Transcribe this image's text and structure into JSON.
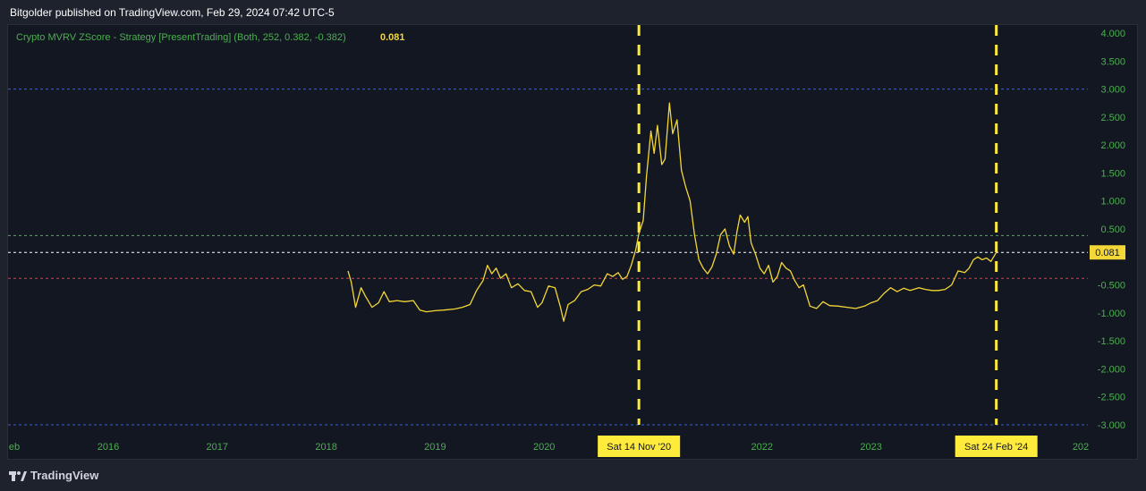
{
  "header": {
    "text": "Bitgolder published on TradingView.com, Feb 29, 2024 07:42 UTC-5"
  },
  "indicator": {
    "label": "Crypto MVRV ZScore - Strategy [PresentTrading] (Both, 252, 0.382, -0.382)",
    "value": "0.081"
  },
  "colors": {
    "background": "#131722",
    "line": "#f3d737",
    "level_blue": "#2962ff",
    "level_green": "#4caf50",
    "level_red": "#f23645",
    "level_white": "#ffffff",
    "marker": "#ffeb3b",
    "axis_text": "#4caf50"
  },
  "footer": {
    "brand": "TradingView"
  },
  "chart_data": {
    "type": "line",
    "ylim": [
      -3.0,
      4.0
    ],
    "y_ticks": [
      "4.000",
      "3.500",
      "3.000",
      "2.500",
      "2.000",
      "1.500",
      "1.000",
      "0.500",
      "0.000",
      "-0.500",
      "-1.000",
      "-1.500",
      "-2.000",
      "-2.500",
      "-3.000"
    ],
    "x_ticks": [
      {
        "label": "eb",
        "x": 2015.1
      },
      {
        "label": "2016",
        "x": 2016.0
      },
      {
        "label": "2017",
        "x": 2017.0
      },
      {
        "label": "2018",
        "x": 2018.0
      },
      {
        "label": "2019",
        "x": 2019.0
      },
      {
        "label": "2020",
        "x": 2020.0
      },
      {
        "label": "2022",
        "x": 2022.0
      },
      {
        "label": "2023",
        "x": 2023.0
      },
      {
        "label": "202",
        "x": 2024.0
      }
    ],
    "horizontal_levels": [
      {
        "value": 3.0,
        "color": "#2962ff"
      },
      {
        "value": 0.382,
        "color": "#4caf50"
      },
      {
        "value": 0.081,
        "color": "#ffffff"
      },
      {
        "value": -0.382,
        "color": "#f23645"
      },
      {
        "value": -3.0,
        "color": "#2962ff"
      }
    ],
    "vertical_markers": [
      {
        "label": "Sat 14 Nov '20",
        "x": 2020.87
      },
      {
        "label": "Sat 24 Feb '24",
        "x": 2024.15
      }
    ],
    "last_value_label": "0.081",
    "series": [
      {
        "values": [
          [
            2018.2,
            -0.25
          ],
          [
            2018.23,
            -0.45
          ],
          [
            2018.27,
            -0.9
          ],
          [
            2018.32,
            -0.55
          ],
          [
            2018.36,
            -0.7
          ],
          [
            2018.42,
            -0.9
          ],
          [
            2018.48,
            -0.82
          ],
          [
            2018.53,
            -0.62
          ],
          [
            2018.58,
            -0.8
          ],
          [
            2018.65,
            -0.78
          ],
          [
            2018.72,
            -0.8
          ],
          [
            2018.8,
            -0.78
          ],
          [
            2018.86,
            -0.95
          ],
          [
            2018.92,
            -0.98
          ],
          [
            2019.0,
            -0.96
          ],
          [
            2019.08,
            -0.95
          ],
          [
            2019.18,
            -0.93
          ],
          [
            2019.25,
            -0.9
          ],
          [
            2019.32,
            -0.85
          ],
          [
            2019.38,
            -0.6
          ],
          [
            2019.44,
            -0.42
          ],
          [
            2019.48,
            -0.15
          ],
          [
            2019.52,
            -0.3
          ],
          [
            2019.56,
            -0.2
          ],
          [
            2019.6,
            -0.38
          ],
          [
            2019.65,
            -0.3
          ],
          [
            2019.7,
            -0.55
          ],
          [
            2019.76,
            -0.48
          ],
          [
            2019.82,
            -0.6
          ],
          [
            2019.88,
            -0.62
          ],
          [
            2019.94,
            -0.9
          ],
          [
            2019.98,
            -0.82
          ],
          [
            2020.04,
            -0.52
          ],
          [
            2020.1,
            -0.55
          ],
          [
            2020.15,
            -0.9
          ],
          [
            2020.18,
            -1.15
          ],
          [
            2020.22,
            -0.85
          ],
          [
            2020.28,
            -0.78
          ],
          [
            2020.34,
            -0.62
          ],
          [
            2020.4,
            -0.58
          ],
          [
            2020.46,
            -0.5
          ],
          [
            2020.52,
            -0.52
          ],
          [
            2020.58,
            -0.3
          ],
          [
            2020.63,
            -0.35
          ],
          [
            2020.68,
            -0.28
          ],
          [
            2020.72,
            -0.4
          ],
          [
            2020.76,
            -0.35
          ],
          [
            2020.8,
            -0.15
          ],
          [
            2020.84,
            0.12
          ],
          [
            2020.87,
            0.42
          ],
          [
            2020.91,
            0.65
          ],
          [
            2020.94,
            1.45
          ],
          [
            2020.98,
            2.25
          ],
          [
            2021.01,
            1.85
          ],
          [
            2021.04,
            2.35
          ],
          [
            2021.08,
            1.65
          ],
          [
            2021.11,
            1.75
          ],
          [
            2021.15,
            2.75
          ],
          [
            2021.18,
            2.2
          ],
          [
            2021.22,
            2.45
          ],
          [
            2021.26,
            1.55
          ],
          [
            2021.3,
            1.25
          ],
          [
            2021.34,
            1.0
          ],
          [
            2021.38,
            0.4
          ],
          [
            2021.42,
            -0.05
          ],
          [
            2021.46,
            -0.2
          ],
          [
            2021.5,
            -0.3
          ],
          [
            2021.54,
            -0.18
          ],
          [
            2021.58,
            0.05
          ],
          [
            2021.62,
            0.4
          ],
          [
            2021.66,
            0.5
          ],
          [
            2021.7,
            0.2
          ],
          [
            2021.74,
            0.05
          ],
          [
            2021.77,
            0.45
          ],
          [
            2021.8,
            0.75
          ],
          [
            2021.84,
            0.62
          ],
          [
            2021.87,
            0.72
          ],
          [
            2021.9,
            0.25
          ],
          [
            2021.94,
            0.05
          ],
          [
            2021.98,
            -0.2
          ],
          [
            2022.02,
            -0.3
          ],
          [
            2022.06,
            -0.15
          ],
          [
            2022.1,
            -0.45
          ],
          [
            2022.14,
            -0.35
          ],
          [
            2022.18,
            -0.1
          ],
          [
            2022.22,
            -0.2
          ],
          [
            2022.26,
            -0.25
          ],
          [
            2022.3,
            -0.42
          ],
          [
            2022.34,
            -0.55
          ],
          [
            2022.38,
            -0.5
          ],
          [
            2022.44,
            -0.88
          ],
          [
            2022.5,
            -0.92
          ],
          [
            2022.56,
            -0.8
          ],
          [
            2022.62,
            -0.87
          ],
          [
            2022.7,
            -0.88
          ],
          [
            2022.78,
            -0.9
          ],
          [
            2022.86,
            -0.92
          ],
          [
            2022.94,
            -0.88
          ],
          [
            2023.0,
            -0.82
          ],
          [
            2023.06,
            -0.78
          ],
          [
            2023.12,
            -0.65
          ],
          [
            2023.18,
            -0.55
          ],
          [
            2023.24,
            -0.62
          ],
          [
            2023.3,
            -0.56
          ],
          [
            2023.36,
            -0.6
          ],
          [
            2023.44,
            -0.55
          ],
          [
            2023.5,
            -0.58
          ],
          [
            2023.56,
            -0.6
          ],
          [
            2023.62,
            -0.6
          ],
          [
            2023.68,
            -0.58
          ],
          [
            2023.74,
            -0.5
          ],
          [
            2023.8,
            -0.25
          ],
          [
            2023.86,
            -0.28
          ],
          [
            2023.9,
            -0.2
          ],
          [
            2023.94,
            -0.05
          ],
          [
            2023.98,
            0.0
          ],
          [
            2024.02,
            -0.05
          ],
          [
            2024.06,
            -0.02
          ],
          [
            2024.1,
            -0.08
          ],
          [
            2024.15,
            0.081
          ]
        ]
      }
    ]
  }
}
